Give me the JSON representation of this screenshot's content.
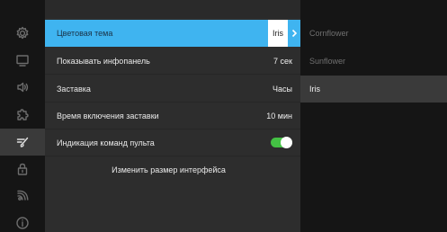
{
  "sidebar": {
    "icons": [
      "gear-icon",
      "monitor-icon",
      "speaker-icon",
      "puzzle-icon",
      "brush-icon",
      "lock-icon",
      "signal-icon",
      "info-icon"
    ],
    "active": "brush-icon"
  },
  "settings": {
    "theme_label": "Цветовая тема",
    "theme_value": "Iris",
    "infobar_label": "Показывать инфопанель",
    "infobar_value": "7 сек",
    "screensaver_label": "Заставка",
    "screensaver_value": "Часы",
    "screensaver_time_label": "Время включения заставки",
    "screensaver_time_value": "10 мин",
    "remote_indication_label": "Индикация команд пульта",
    "remote_indication_on": true,
    "resize_label": "Изменить размер интерфейса"
  },
  "theme_options": [
    "Cornflower",
    "Sunflower",
    "Iris"
  ],
  "theme_selected": "Iris",
  "colors": {
    "accent": "#3fb4f0",
    "toggle_on": "#44c144",
    "panel_bg": "#2d2d2d",
    "rail_bg": "#151515"
  }
}
